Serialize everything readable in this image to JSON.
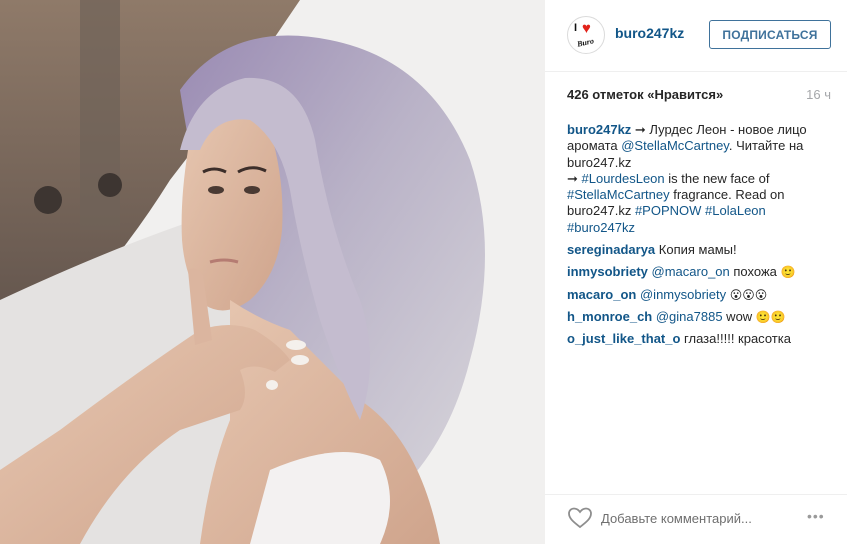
{
  "post": {
    "photo_alt": "Photo",
    "author": "buro247kz",
    "follow_label": "ПОДПИСАТЬСЯ",
    "likes_text": "426 отметок «Нравится»",
    "time_ago": "16 ч",
    "avatar": {
      "letter": "I",
      "heart": "♥",
      "text": "Buro"
    }
  },
  "caption": {
    "username": "buro247kz",
    "l1_text": " ➞ Лурдес Леон - новое лицо аромата ",
    "l1_tag": "@StellaMcCartney",
    "l1_text2": ". Читайте на buro247.kz",
    "l2_arrow": "➞ ",
    "l2_tag": "#LourdesLeon",
    "l2_text": " is the new face of ",
    "l2_tag2": "#StellaMcCartney",
    "l2_text2": " fragrance. Read on buro247.kz ",
    "l2_tag3": "#POPNOW",
    "l2_tag4": "#LolaLeon",
    "l2_tag5": "#buro247kz"
  },
  "comments": [
    {
      "username": "sereginadarya",
      "mention": "",
      "text": " Копия мамы!",
      "emoji": ""
    },
    {
      "username": "inmysobriety",
      "mention": " @macaro_on",
      "text": " похожа ",
      "emoji": "🙂"
    },
    {
      "username": "macaro_on",
      "mention": " @inmysobriety",
      "text": " ",
      "emoji": "😮😮😮"
    },
    {
      "username": "h_monroe_ch",
      "mention": " @gina7885",
      "text": " wow ",
      "emoji": "🙂🙂"
    },
    {
      "username": "o_just_like_that_o",
      "mention": "",
      "text": " глаза!!!!! красотка",
      "emoji": ""
    }
  ],
  "footer": {
    "like_icon": "heart-outline-icon",
    "comment_placeholder": "Добавьте комментарий...",
    "more_label": "•••"
  },
  "colors": {
    "link": "#125688",
    "follow_border": "#3f729b",
    "muted": "#a5a7aa"
  }
}
